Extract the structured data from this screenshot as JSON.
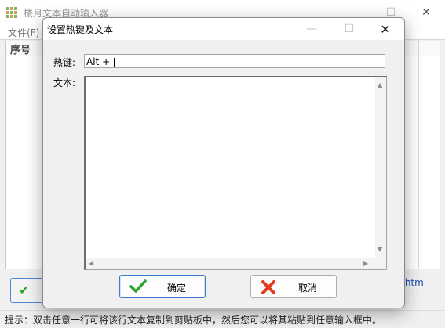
{
  "main_window": {
    "title": "楼月文本自动输入器",
    "menu": {
      "file_label": "文件(F)"
    },
    "list": {
      "column_index_label": "序号"
    },
    "link_text": ".htm",
    "status_text": "提示：双击任意一行可将该行文本复制到剪贴板中，然后您可以将其粘贴到任意输入框中。"
  },
  "dialog": {
    "title": "设置热键及文本",
    "hotkey_label": "热键:",
    "hotkey_value": "Alt + ",
    "text_label": "文本:",
    "text_value": "",
    "ok_label": "确定",
    "cancel_label": "取消"
  },
  "icons": {
    "check": "check-icon",
    "cross": "cross-icon",
    "minimize": "minimize-icon",
    "maximize": "maximize-icon",
    "close": "close-icon"
  },
  "colors": {
    "ok_check": "#2aa42a",
    "cancel_cross": "#e03c1e",
    "link": "#1e4fb5",
    "default_button_border": "#3c7bd1"
  }
}
